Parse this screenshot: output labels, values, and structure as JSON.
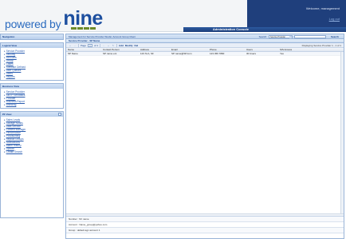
{
  "header": {
    "logo_powered": "powered by",
    "logo_nine": "nine",
    "welcome": "Welcome, management",
    "logout": "Log out",
    "console_title": "Administration Console"
  },
  "sidebar": {
    "navigation_title": "Navigation",
    "logical_view": {
      "title": "Logical View",
      "items": [
        "Service Provider",
        "Security",
        "Accounts",
        "Group",
        "Cases",
        "Software Defined",
        "User Queues",
        "Users",
        "Reports"
      ]
    },
    "business_view": {
      "title": "Business View",
      "items": [
        "Service Provider",
        "SMTP Sendback",
        "Provider",
        "Business Report",
        "Branding"
      ]
    },
    "pf_view": {
      "title": "PF View",
      "items": [
        "Sales Leads",
        "Storage Nodes",
        "Data Service",
        "Content Manager",
        "Performance",
        "Provisioning",
        "Replica Groups",
        "Notifications",
        "Alarm History",
        "Upload",
        "Create Search"
      ]
    }
  },
  "main": {
    "breadcrumb": "Management for Service Provider Studio: Account Group Client",
    "search": {
      "label": "Search:",
      "scope_value": "Service Provider",
      "query_value": "",
      "button": "Search"
    },
    "grid_title": "Service Provider - SP Name",
    "toolbar": {
      "page_label": "Page",
      "page_value": "1",
      "of_label": "of 1",
      "add": "Add",
      "modify": "Modify",
      "delete": "Del",
      "status": "Displaying Service Provider 1 - 1 of 1"
    },
    "columns": [
      "Name",
      "Contact Person",
      "Address",
      "Email",
      "Phone",
      "Users",
      "SIS Access"
    ],
    "rows": [
      [
        "SP Name",
        "SP name ent",
        "123 St A, SF",
        "SP name@SP.com",
        "123 456 7890",
        "30 Users",
        "Yes"
      ]
    ],
    "details": [
      "Number : SV name",
      "Account : Name_group@yahoo.com",
      "Group : default agc account 1"
    ]
  }
}
